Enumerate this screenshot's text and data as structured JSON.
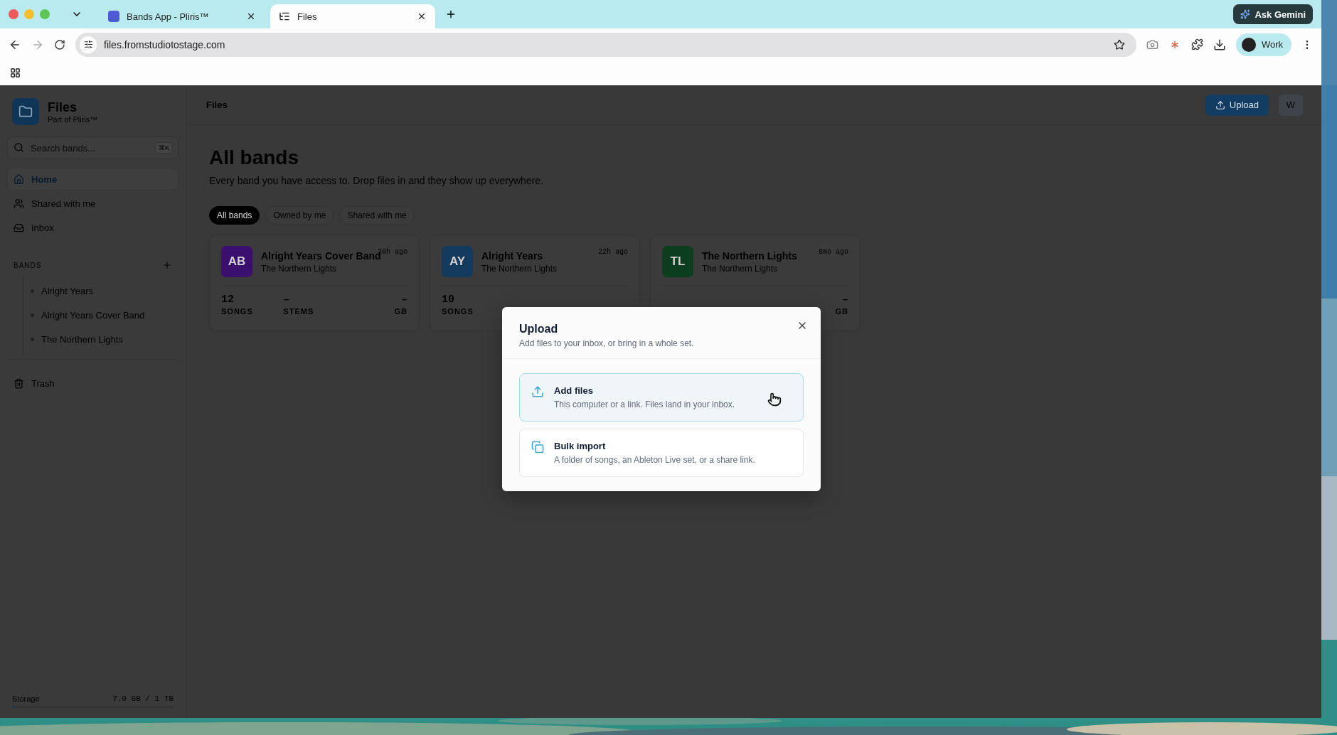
{
  "browser": {
    "tabs": [
      {
        "title": "Bands App - Pliris™",
        "selected": false,
        "kind": "app"
      },
      {
        "title": "Files",
        "selected": true,
        "kind": "files"
      }
    ],
    "url": "files.fromstudiotostage.com",
    "gemini": "Ask Gemini",
    "profile": "Work"
  },
  "sidebar": {
    "app_name": "Files",
    "app_sub": "Part of Pliris™",
    "search": {
      "placeholder": "Search bands...",
      "shortcut": "⌘K"
    },
    "nav": [
      {
        "label": "Home",
        "selected": true
      },
      {
        "label": "Shared with me",
        "selected": false
      },
      {
        "label": "Inbox",
        "selected": false
      }
    ],
    "bands_heading": "BANDS",
    "bands": [
      "Alright Years",
      "Alright Years Cover Band",
      "The Northern Lights"
    ],
    "trash": "Trash",
    "storage": {
      "label": "Storage",
      "value": "7.0 GB / 1 TB",
      "level": 0.007
    }
  },
  "topbar": {
    "title": "Files",
    "upload": "Upload",
    "user": "W"
  },
  "main": {
    "title": "All bands",
    "subtitle": "Every band you have access to. Drop files in and they show up everywhere.",
    "filters": [
      {
        "label": "All bands",
        "selected": true
      },
      {
        "label": "Owned by me",
        "selected": false
      },
      {
        "label": "Shared with me",
        "selected": false
      }
    ],
    "cards": [
      {
        "initials": "AB",
        "color": "#3b0f6e",
        "name": "Alright Years Cover Band",
        "owner": "The Northern Lights",
        "time": "20h ago",
        "stats": {
          "left": {
            "value": "12",
            "label": "SONGS"
          },
          "center": {
            "value": "–",
            "label": "STEMS"
          },
          "right": {
            "value": "–",
            "label": "GB"
          }
        }
      },
      {
        "initials": "AY",
        "color": "#123a5e",
        "name": "Alright Years",
        "owner": "The Northern Lights",
        "time": "22h ago",
        "stats": {
          "left": {
            "value": "10",
            "label": "SONGS"
          }
        }
      },
      {
        "initials": "TL",
        "color": "#0c3d1e",
        "name": "The Northern Lights",
        "owner": "The Northern Lights",
        "time": "8mo ago",
        "stats": {
          "right": {
            "value": "–",
            "label": "GB"
          }
        }
      }
    ]
  },
  "modal": {
    "title": "Upload",
    "subtitle": "Add files to your inbox, or bring in a whole set.",
    "options": [
      {
        "title": "Add files",
        "description": "This computer or a link. Files land in your inbox.",
        "selected": true
      },
      {
        "title": "Bulk import",
        "description": "A folder of songs, an Ableton Live set, or a share link.",
        "selected": false
      }
    ]
  }
}
